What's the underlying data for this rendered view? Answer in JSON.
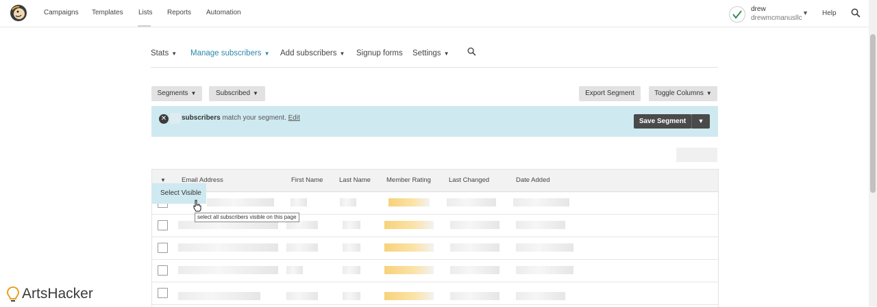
{
  "topnav": {
    "items": [
      "Campaigns",
      "Templates",
      "Lists",
      "Reports",
      "Automation"
    ],
    "account_name": "drew",
    "account_org": "drewmcmanusllc",
    "help": "Help"
  },
  "subnav": {
    "stats": "Stats",
    "manage": "Manage subscribers",
    "add": "Add subscribers",
    "signup": "Signup forms",
    "settings": "Settings"
  },
  "toolbar": {
    "segments": "Segments",
    "subscribed": "Subscribed",
    "export": "Export Segment",
    "toggle": "Toggle Columns"
  },
  "segment_banner": {
    "count_label": "subscribers",
    "match_text": " match your segment. ",
    "edit_link": "Edit",
    "save": "Save Segment"
  },
  "table": {
    "columns": [
      "Email Address",
      "First Name",
      "Last Name",
      "Member Rating",
      "Last Changed",
      "Date Added"
    ]
  },
  "select_popover": "Select Visible",
  "tooltip": "select all subscribers visible on this page",
  "watermark": "ArtsHacker",
  "colors": {
    "accent": "#2a89a8",
    "banner": "#cfe9f0",
    "dark_button": "#4a4a4a",
    "rating": "#f7d27a"
  }
}
